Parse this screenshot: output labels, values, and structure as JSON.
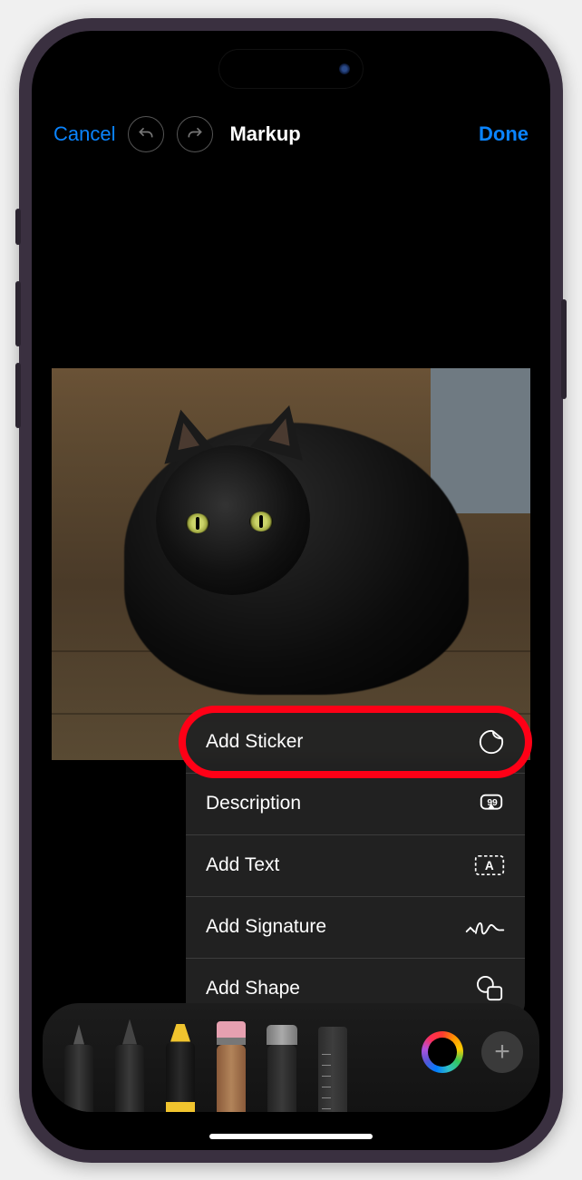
{
  "header": {
    "cancel_label": "Cancel",
    "title": "Markup",
    "done_label": "Done"
  },
  "menu": {
    "items": [
      {
        "label": "Add Sticker",
        "icon": "sticker-icon",
        "highlighted": true
      },
      {
        "label": "Description",
        "icon": "description-icon",
        "highlighted": false
      },
      {
        "label": "Add Text",
        "icon": "text-icon",
        "highlighted": false
      },
      {
        "label": "Add Signature",
        "icon": "signature-icon",
        "highlighted": false
      },
      {
        "label": "Add Shape",
        "icon": "shapes-icon",
        "highlighted": false
      }
    ]
  },
  "tools": {
    "marker_value": "80",
    "items": [
      "pen",
      "felt",
      "marker",
      "pencil",
      "eraser",
      "ruler"
    ]
  }
}
